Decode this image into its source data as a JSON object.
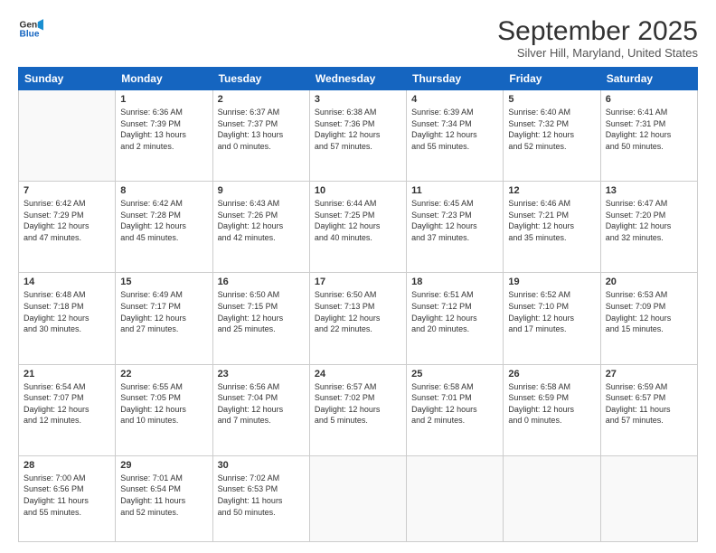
{
  "logo": {
    "line1": "General",
    "line2": "Blue"
  },
  "title": "September 2025",
  "location": "Silver Hill, Maryland, United States",
  "weekdays": [
    "Sunday",
    "Monday",
    "Tuesday",
    "Wednesday",
    "Thursday",
    "Friday",
    "Saturday"
  ],
  "weeks": [
    [
      {
        "day": "",
        "info": ""
      },
      {
        "day": "1",
        "info": "Sunrise: 6:36 AM\nSunset: 7:39 PM\nDaylight: 13 hours\nand 2 minutes."
      },
      {
        "day": "2",
        "info": "Sunrise: 6:37 AM\nSunset: 7:37 PM\nDaylight: 13 hours\nand 0 minutes."
      },
      {
        "day": "3",
        "info": "Sunrise: 6:38 AM\nSunset: 7:36 PM\nDaylight: 12 hours\nand 57 minutes."
      },
      {
        "day": "4",
        "info": "Sunrise: 6:39 AM\nSunset: 7:34 PM\nDaylight: 12 hours\nand 55 minutes."
      },
      {
        "day": "5",
        "info": "Sunrise: 6:40 AM\nSunset: 7:32 PM\nDaylight: 12 hours\nand 52 minutes."
      },
      {
        "day": "6",
        "info": "Sunrise: 6:41 AM\nSunset: 7:31 PM\nDaylight: 12 hours\nand 50 minutes."
      }
    ],
    [
      {
        "day": "7",
        "info": "Sunrise: 6:42 AM\nSunset: 7:29 PM\nDaylight: 12 hours\nand 47 minutes."
      },
      {
        "day": "8",
        "info": "Sunrise: 6:42 AM\nSunset: 7:28 PM\nDaylight: 12 hours\nand 45 minutes."
      },
      {
        "day": "9",
        "info": "Sunrise: 6:43 AM\nSunset: 7:26 PM\nDaylight: 12 hours\nand 42 minutes."
      },
      {
        "day": "10",
        "info": "Sunrise: 6:44 AM\nSunset: 7:25 PM\nDaylight: 12 hours\nand 40 minutes."
      },
      {
        "day": "11",
        "info": "Sunrise: 6:45 AM\nSunset: 7:23 PM\nDaylight: 12 hours\nand 37 minutes."
      },
      {
        "day": "12",
        "info": "Sunrise: 6:46 AM\nSunset: 7:21 PM\nDaylight: 12 hours\nand 35 minutes."
      },
      {
        "day": "13",
        "info": "Sunrise: 6:47 AM\nSunset: 7:20 PM\nDaylight: 12 hours\nand 32 minutes."
      }
    ],
    [
      {
        "day": "14",
        "info": "Sunrise: 6:48 AM\nSunset: 7:18 PM\nDaylight: 12 hours\nand 30 minutes."
      },
      {
        "day": "15",
        "info": "Sunrise: 6:49 AM\nSunset: 7:17 PM\nDaylight: 12 hours\nand 27 minutes."
      },
      {
        "day": "16",
        "info": "Sunrise: 6:50 AM\nSunset: 7:15 PM\nDaylight: 12 hours\nand 25 minutes."
      },
      {
        "day": "17",
        "info": "Sunrise: 6:50 AM\nSunset: 7:13 PM\nDaylight: 12 hours\nand 22 minutes."
      },
      {
        "day": "18",
        "info": "Sunrise: 6:51 AM\nSunset: 7:12 PM\nDaylight: 12 hours\nand 20 minutes."
      },
      {
        "day": "19",
        "info": "Sunrise: 6:52 AM\nSunset: 7:10 PM\nDaylight: 12 hours\nand 17 minutes."
      },
      {
        "day": "20",
        "info": "Sunrise: 6:53 AM\nSunset: 7:09 PM\nDaylight: 12 hours\nand 15 minutes."
      }
    ],
    [
      {
        "day": "21",
        "info": "Sunrise: 6:54 AM\nSunset: 7:07 PM\nDaylight: 12 hours\nand 12 minutes."
      },
      {
        "day": "22",
        "info": "Sunrise: 6:55 AM\nSunset: 7:05 PM\nDaylight: 12 hours\nand 10 minutes."
      },
      {
        "day": "23",
        "info": "Sunrise: 6:56 AM\nSunset: 7:04 PM\nDaylight: 12 hours\nand 7 minutes."
      },
      {
        "day": "24",
        "info": "Sunrise: 6:57 AM\nSunset: 7:02 PM\nDaylight: 12 hours\nand 5 minutes."
      },
      {
        "day": "25",
        "info": "Sunrise: 6:58 AM\nSunset: 7:01 PM\nDaylight: 12 hours\nand 2 minutes."
      },
      {
        "day": "26",
        "info": "Sunrise: 6:58 AM\nSunset: 6:59 PM\nDaylight: 12 hours\nand 0 minutes."
      },
      {
        "day": "27",
        "info": "Sunrise: 6:59 AM\nSunset: 6:57 PM\nDaylight: 11 hours\nand 57 minutes."
      }
    ],
    [
      {
        "day": "28",
        "info": "Sunrise: 7:00 AM\nSunset: 6:56 PM\nDaylight: 11 hours\nand 55 minutes."
      },
      {
        "day": "29",
        "info": "Sunrise: 7:01 AM\nSunset: 6:54 PM\nDaylight: 11 hours\nand 52 minutes."
      },
      {
        "day": "30",
        "info": "Sunrise: 7:02 AM\nSunset: 6:53 PM\nDaylight: 11 hours\nand 50 minutes."
      },
      {
        "day": "",
        "info": ""
      },
      {
        "day": "",
        "info": ""
      },
      {
        "day": "",
        "info": ""
      },
      {
        "day": "",
        "info": ""
      }
    ]
  ]
}
